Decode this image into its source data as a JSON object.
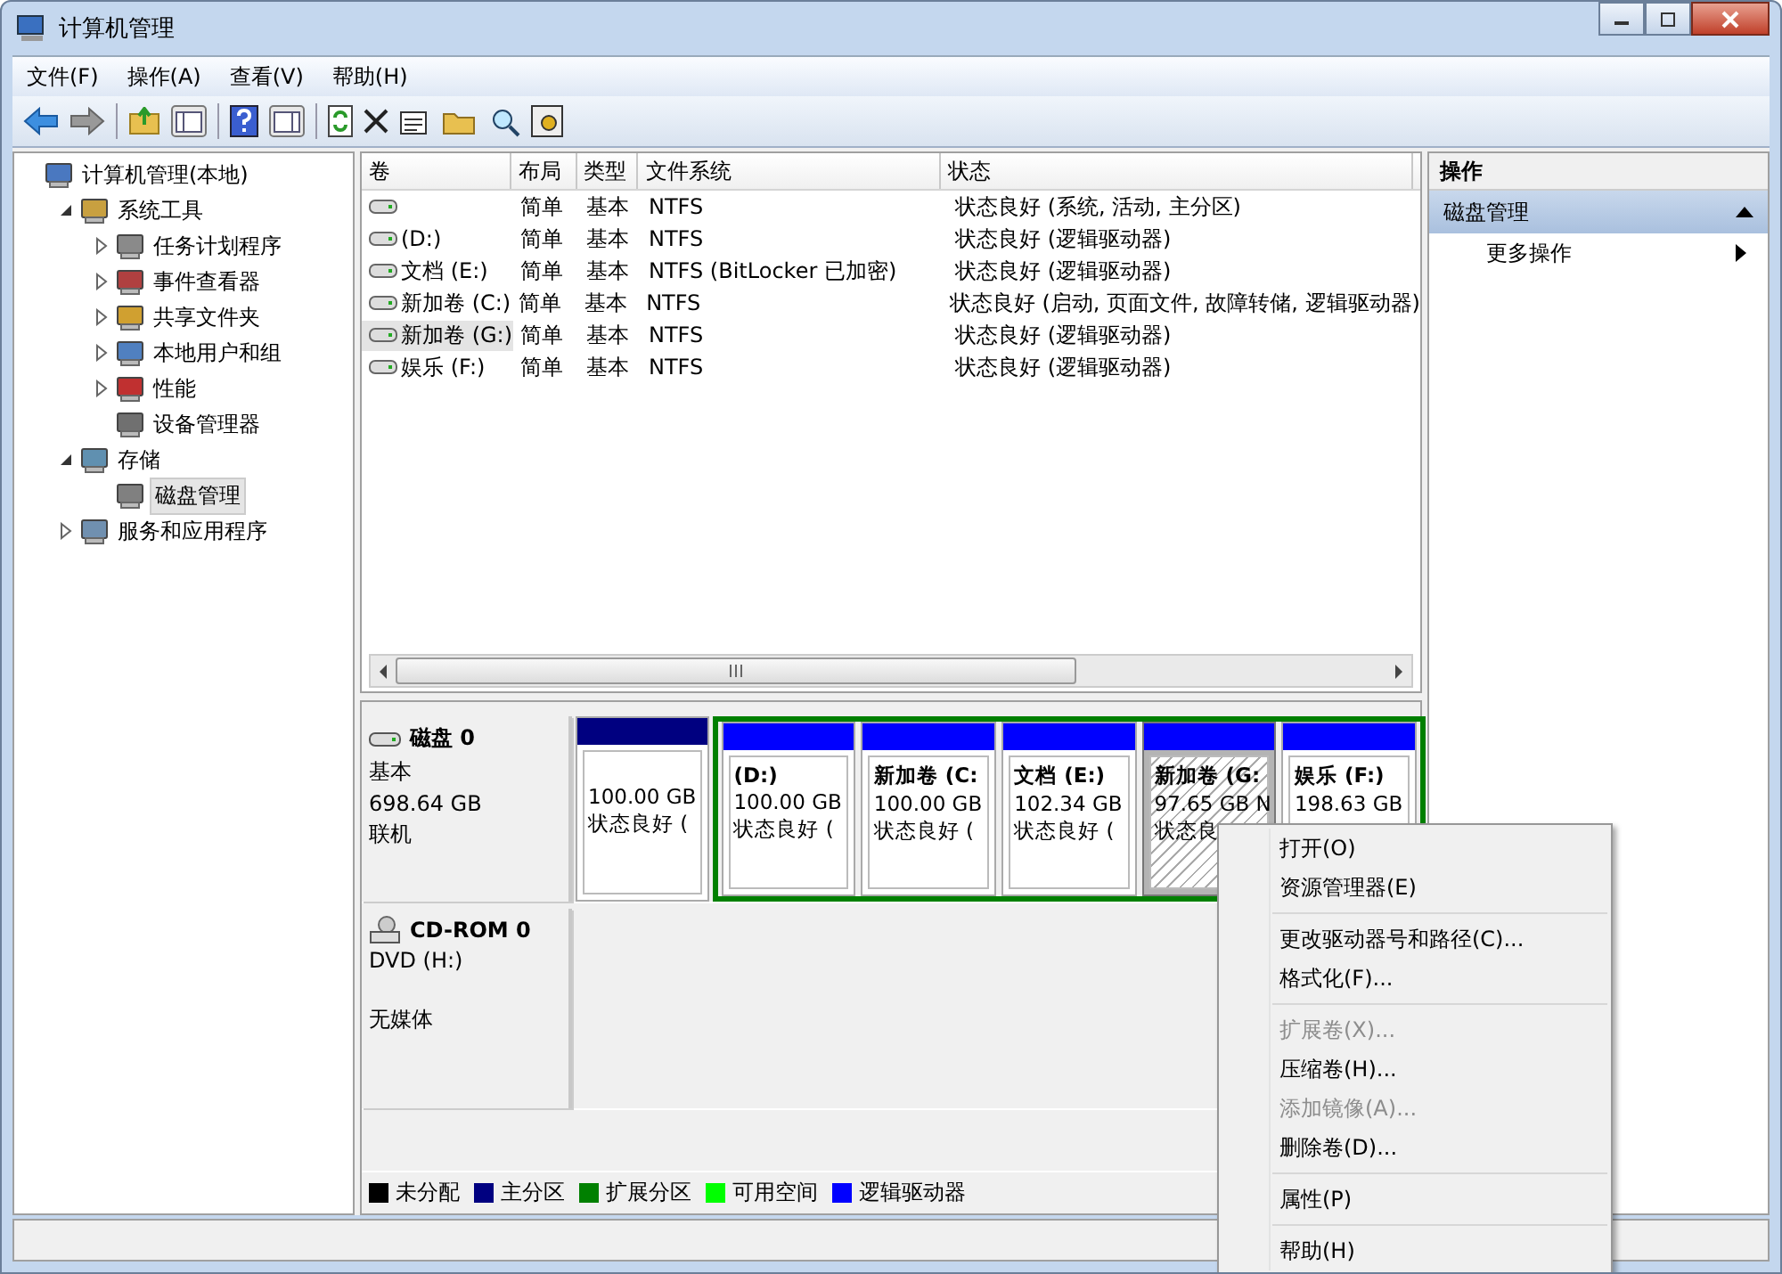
{
  "window": {
    "title": "计算机管理"
  },
  "menu": [
    "文件(F)",
    "操作(A)",
    "查看(V)",
    "帮助(H)"
  ],
  "tree": [
    {
      "label": "计算机管理(本地)",
      "expandable": false,
      "selected": false,
      "children": [
        {
          "label": "系统工具",
          "expandable": true,
          "expanded": true,
          "selected": false,
          "children": [
            {
              "label": "任务计划程序",
              "expandable": true,
              "expanded": false,
              "selected": false
            },
            {
              "label": "事件查看器",
              "expandable": true,
              "expanded": false,
              "selected": false
            },
            {
              "label": "共享文件夹",
              "expandable": true,
              "expanded": false,
              "selected": false
            },
            {
              "label": "本地用户和组",
              "expandable": true,
              "expanded": false,
              "selected": false
            },
            {
              "label": "性能",
              "expandable": true,
              "expanded": false,
              "selected": false
            },
            {
              "label": "设备管理器",
              "expandable": false,
              "selected": false
            }
          ]
        },
        {
          "label": "存储",
          "expandable": true,
          "expanded": true,
          "selected": false,
          "children": [
            {
              "label": "磁盘管理",
              "expandable": false,
              "selected": true
            }
          ]
        },
        {
          "label": "服务和应用程序",
          "expandable": true,
          "expanded": false,
          "selected": false
        }
      ]
    }
  ],
  "table": {
    "columns": [
      "卷",
      "布局",
      "类型",
      "文件系统",
      "状态"
    ],
    "rows": [
      {
        "volume": "",
        "layout": "简单",
        "type": "基本",
        "fs": "NTFS",
        "status": "状态良好 (系统, 活动, 主分区)",
        "selected": false
      },
      {
        "volume": " (D:)",
        "layout": "简单",
        "type": "基本",
        "fs": "NTFS",
        "status": "状态良好 (逻辑驱动器)",
        "selected": false
      },
      {
        "volume": "文档 (E:)",
        "layout": "简单",
        "type": "基本",
        "fs": "NTFS (BitLocker 已加密)",
        "status": "状态良好 (逻辑驱动器)",
        "selected": false
      },
      {
        "volume": "新加卷 (C:)",
        "layout": "简单",
        "type": "基本",
        "fs": "NTFS",
        "status": "状态良好 (启动, 页面文件, 故障转储, 逻辑驱动器)",
        "selected": false
      },
      {
        "volume": "新加卷 (G:)",
        "layout": "简单",
        "type": "基本",
        "fs": "NTFS",
        "status": "状态良好 (逻辑驱动器)",
        "selected": true
      },
      {
        "volume": "娱乐 (F:)",
        "layout": "简单",
        "type": "基本",
        "fs": "NTFS",
        "status": "状态良好 (逻辑驱动器)",
        "selected": false
      }
    ]
  },
  "disks": [
    {
      "name": "磁盘 0",
      "kind": "disk",
      "type": "基本",
      "size": "698.64 GB",
      "status": "联机",
      "partitions": [
        {
          "kind": "primary",
          "size": "100.00 GB",
          "status": "状态良好 (",
          "selected": false
        },
        {
          "kind": "logical",
          "label": " (D:)",
          "size": "100.00 GB",
          "status": "状态良好 (",
          "selected": false
        },
        {
          "kind": "logical",
          "label": "新加卷 (C:",
          "size": "100.00 GB",
          "status": "状态良好 (",
          "selected": false
        },
        {
          "kind": "logical",
          "label": "文档 (E:)",
          "size": "102.34 GB",
          "status": "状态良好 (",
          "selected": false
        },
        {
          "kind": "logical",
          "label": "新加卷 (G:",
          "size": "97.65 GB N",
          "status": "状态良",
          "selected": true
        },
        {
          "kind": "logical",
          "label": "娱乐 (F:)",
          "size": "198.63 GB",
          "selected": false
        }
      ]
    },
    {
      "name": "CD-ROM 0",
      "kind": "cdrom",
      "type": "DVD (H:)",
      "status": "无媒体"
    }
  ],
  "legend": [
    {
      "label": "未分配",
      "color": "#000000"
    },
    {
      "label": "主分区",
      "color": "#000080"
    },
    {
      "label": "扩展分区",
      "color": "#008000"
    },
    {
      "label": "可用空间",
      "color": "#00ff00"
    },
    {
      "label": "逻辑驱动器",
      "color": "#0000ff"
    }
  ],
  "actions": {
    "header": "操作",
    "section": "磁盘管理",
    "items": [
      "更多操作"
    ]
  },
  "context_menu": [
    {
      "kind": "item",
      "label": "打开(O)",
      "disabled": false
    },
    {
      "kind": "item",
      "label": "资源管理器(E)",
      "disabled": false
    },
    {
      "kind": "separator"
    },
    {
      "kind": "item",
      "label": "更改驱动器号和路径(C)...",
      "disabled": false
    },
    {
      "kind": "item",
      "label": "格式化(F)...",
      "disabled": false
    },
    {
      "kind": "separator"
    },
    {
      "kind": "item",
      "label": "扩展卷(X)...",
      "disabled": true
    },
    {
      "kind": "item",
      "label": "压缩卷(H)...",
      "disabled": false
    },
    {
      "kind": "item",
      "label": "添加镜像(A)...",
      "disabled": true
    },
    {
      "kind": "item",
      "label": "删除卷(D)...",
      "disabled": false
    },
    {
      "kind": "separator"
    },
    {
      "kind": "item",
      "label": "属性(P)",
      "disabled": false
    },
    {
      "kind": "separator"
    },
    {
      "kind": "item",
      "label": "帮助(H)",
      "disabled": false
    }
  ]
}
